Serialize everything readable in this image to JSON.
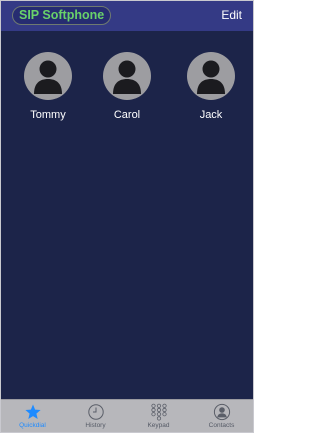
{
  "header": {
    "title": "SIP Softphone",
    "edit_label": "Edit"
  },
  "contacts": [
    {
      "name": "Tommy",
      "icon": "person-silhouette-icon"
    },
    {
      "name": "Carol",
      "icon": "person-silhouette-icon"
    },
    {
      "name": "Jack",
      "icon": "person-silhouette-icon"
    }
  ],
  "tabs": [
    {
      "label": "Quickdial",
      "icon": "star-icon",
      "active": true
    },
    {
      "label": "History",
      "icon": "clock-icon",
      "active": false
    },
    {
      "label": "Keypad",
      "icon": "keypad-icon",
      "active": false
    },
    {
      "label": "Contacts",
      "icon": "contacts-icon",
      "active": false
    }
  ],
  "colors": {
    "navbar": "#343a85",
    "background": "#1c2449",
    "title_text": "#69d26a",
    "tabbar": "#b7b7bb",
    "active_tab": "#1f8bff"
  }
}
